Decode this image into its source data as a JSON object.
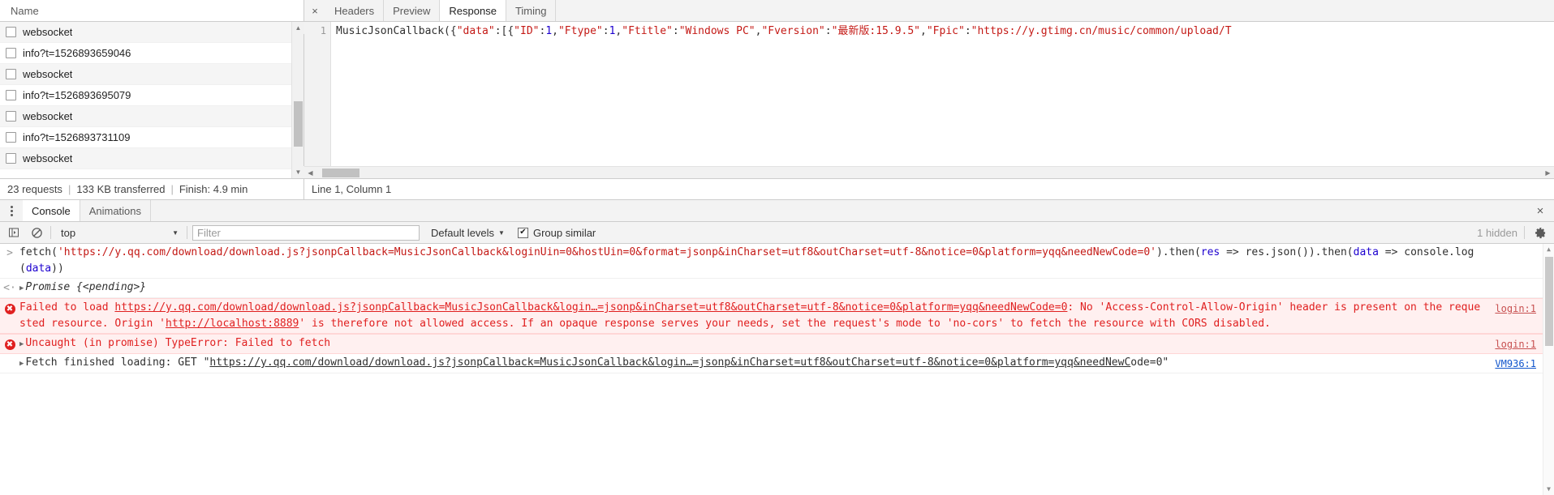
{
  "network": {
    "column_header": "Name",
    "requests": [
      {
        "name": "websocket"
      },
      {
        "name": "info?t=1526893659046"
      },
      {
        "name": "websocket"
      },
      {
        "name": "info?t=1526893695079"
      },
      {
        "name": "websocket"
      },
      {
        "name": "info?t=1526893731109"
      },
      {
        "name": "websocket"
      }
    ],
    "status": {
      "requests": "23 requests",
      "transferred": "133 KB transferred",
      "finish": "Finish: 4.9 min",
      "separator": "|",
      "cursor_position": "Line 1, Column 1"
    }
  },
  "response_panel": {
    "close_icon": "×",
    "tabs": [
      {
        "label": "Headers",
        "active": false
      },
      {
        "label": "Preview",
        "active": false
      },
      {
        "label": "Response",
        "active": true
      },
      {
        "label": "Timing",
        "active": false
      }
    ],
    "line_number": "1",
    "code_tokens": [
      {
        "t": "MusicJsonCallback({",
        "c": "plain"
      },
      {
        "t": "\"data\"",
        "c": "string"
      },
      {
        "t": ":[{",
        "c": "plain"
      },
      {
        "t": "\"ID\"",
        "c": "string"
      },
      {
        "t": ":",
        "c": "plain"
      },
      {
        "t": "1",
        "c": "number"
      },
      {
        "t": ",",
        "c": "plain"
      },
      {
        "t": "\"Ftype\"",
        "c": "string"
      },
      {
        "t": ":",
        "c": "plain"
      },
      {
        "t": "1",
        "c": "number"
      },
      {
        "t": ",",
        "c": "plain"
      },
      {
        "t": "\"Ftitle\"",
        "c": "string"
      },
      {
        "t": ":",
        "c": "plain"
      },
      {
        "t": "\"Windows PC\"",
        "c": "string"
      },
      {
        "t": ",",
        "c": "plain"
      },
      {
        "t": "\"Fversion\"",
        "c": "string"
      },
      {
        "t": ":",
        "c": "plain"
      },
      {
        "t": "\"最新版:15.9.5\"",
        "c": "string"
      },
      {
        "t": ",",
        "c": "plain"
      },
      {
        "t": "\"Fpic\"",
        "c": "string"
      },
      {
        "t": ":",
        "c": "plain"
      },
      {
        "t": "\"https://y.gtimg.cn/music/common/upload/T",
        "c": "string"
      }
    ]
  },
  "drawer": {
    "kebab_icon": "more-options",
    "tabs": [
      {
        "label": "Console",
        "active": true
      },
      {
        "label": "Animations",
        "active": false
      }
    ],
    "close_icon": "×"
  },
  "console_toolbar": {
    "sidebar_icon": "show-console-sidebar",
    "clear_icon": "clear-console",
    "context": "top",
    "context_caret": "▼",
    "filter_placeholder": "Filter",
    "filter_value": "",
    "levels_label": "Default levels",
    "levels_caret": "▼",
    "group_similar_label": "Group similar",
    "group_similar_checked": true,
    "checkmark": "✔",
    "hidden_count": "1 hidden",
    "settings_icon": "gear-icon"
  },
  "console_messages": [
    {
      "kind": "input",
      "prompt": ">",
      "tokens": [
        {
          "t": "fetch(",
          "c": "plain"
        },
        {
          "t": "'https://y.qq.com/download/download.js?jsonpCallback=MusicJsonCallback&loginUin=0&hostUin=0&format=jsonp&inCharset=utf8&outCharset=utf-8&notice=0&platform=yqq&needNewCode=0'",
          "c": "string"
        },
        {
          "t": ").then(",
          "c": "plain"
        },
        {
          "t": "res",
          "c": "kw"
        },
        {
          "t": " => res.json()).then(",
          "c": "plain"
        },
        {
          "t": "data",
          "c": "kw"
        },
        {
          "t": " => console.log(",
          "c": "plain"
        },
        {
          "t": "data",
          "c": "kw"
        },
        {
          "t": "))",
          "c": "plain"
        }
      ]
    },
    {
      "kind": "result",
      "prompt": "<·",
      "triangle": "▶",
      "text": "Promise {<pending>}"
    },
    {
      "kind": "error",
      "icon": "error-icon",
      "icon_glyph": "✖",
      "segments": [
        {
          "t": "Failed to load ",
          "link": false
        },
        {
          "t": "https://y.qq.com/download/download.js?jsonpCallback=MusicJsonCallback&login…=jsonp&inCharset=utf8&outCharset=utf-8&notice=0&platform=yqq&needNewCode=0",
          "link": true
        },
        {
          "t": ": No 'Access-Control-Allow-Origin' header is present on the requested resource. Origin '",
          "link": false
        },
        {
          "t": "http://localhost:8889",
          "link": true
        },
        {
          "t": "' is therefore not allowed access. If an opaque response serves your needs, set the request's mode to 'no-cors' to fetch the resource with CORS disabled.",
          "link": false
        }
      ],
      "source": "login:1"
    },
    {
      "kind": "error",
      "icon": "error-icon",
      "icon_glyph": "✖",
      "triangle": "▶",
      "segments": [
        {
          "t": "Uncaught (in promise) TypeError: Failed to fetch",
          "link": false
        }
      ],
      "source": "login:1"
    },
    {
      "kind": "info",
      "triangle": "▶",
      "segments": [
        {
          "t": "Fetch finished loading: GET \"",
          "link": false
        },
        {
          "t": "https://y.qq.com/download/download.js?jsonpCallback=MusicJsonCallback&login…=jsonp&inCharset=utf8&outCharset=utf-8&notice=0&platform=yqq&needNewC",
          "link": true
        },
        {
          "t": "ode=0\"",
          "link": false
        }
      ],
      "source": "VM936:1"
    }
  ],
  "colors": {
    "error_red": "#e02020",
    "error_bg": "#fff0f0",
    "string_red": "#c41a16",
    "number_blue": "#1c00cf",
    "link_blue": "#1155cc",
    "toolbar_bg": "#f3f3f3"
  }
}
